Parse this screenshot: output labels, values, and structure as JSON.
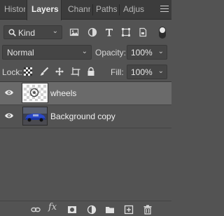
{
  "tabs": [
    {
      "label": "Histor",
      "active": false
    },
    {
      "label": "Layers",
      "active": true
    },
    {
      "label": "Chann",
      "active": false
    },
    {
      "label": "Paths",
      "active": false
    },
    {
      "label": "Adjus",
      "active": false
    }
  ],
  "filter": {
    "kind_label": "Kind",
    "icons": [
      "image-filter-icon",
      "adjustment-filter-icon",
      "type-filter-icon",
      "shape-filter-icon",
      "smart-object-filter-icon",
      "filter-toggle"
    ]
  },
  "blend": {
    "mode": "Normal",
    "opacity_label": "Opacity:",
    "opacity_value": "100%"
  },
  "lock": {
    "label": "Lock:",
    "icons": [
      "lock-transparent-icon",
      "lock-image-icon",
      "lock-position-icon",
      "lock-artboard-icon",
      "lock-all-icon"
    ],
    "fill_label": "Fill:",
    "fill_value": "100%"
  },
  "layers": [
    {
      "name": "wheels",
      "visible": true,
      "selected": true
    },
    {
      "name": "Background copy",
      "visible": true,
      "selected": false
    }
  ],
  "bottom_icons": [
    "link-icon",
    "fx-icon",
    "mask-icon",
    "adjustment-icon",
    "folder-icon",
    "new-layer-icon",
    "trash-icon"
  ],
  "fx_label": "fx",
  "colors": {
    "panel_bg": "#535353",
    "tab_bg": "#3c3c3c",
    "selected_row": "#6a6a6a",
    "text": "#dcdcdc"
  }
}
